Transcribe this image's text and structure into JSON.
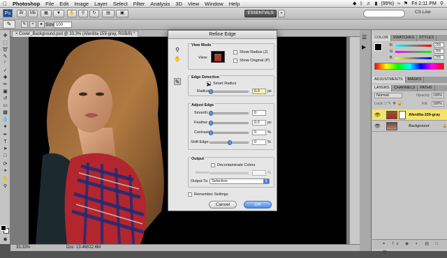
{
  "menubar": {
    "app_name": "Photoshop",
    "items": [
      "File",
      "Edit",
      "Image",
      "Layer",
      "Select",
      "Filter",
      "Analysis",
      "3D",
      "View",
      "Window",
      "Help"
    ],
    "ps_badge": "Ps",
    "battery": "(99%)",
    "clock": "Fri 2:11 PM"
  },
  "appbar": {
    "workspace": "ESSENTIALS",
    "cs_live": "CS Live"
  },
  "options": {
    "size_label": "Size:",
    "size_value": "100"
  },
  "document": {
    "tab_title": "Cover_Background.psd @ 33.3% (Aferdita-159-gray, RGB/8) *",
    "zoom": "33.33%",
    "doc_info": "Doc: 13.4M/22.6M"
  },
  "panels": {
    "color_tabs": [
      "COLOR",
      "SWATCHES",
      "STYLES"
    ],
    "adj_tabs": [
      "ADJUSTMENTS",
      "MASKS"
    ],
    "layer_tabs": [
      "LAYERS",
      "CHANNELS",
      "PATHS"
    ],
    "blend_mode": "Normal",
    "opacity_label": "Opacity:",
    "opacity_value": "100%",
    "lock_label": "Lock:",
    "fill_label": "Fill:",
    "fill_value": "100%",
    "channels": [
      "R",
      "G",
      "B"
    ],
    "channel_values": [
      "255",
      "255",
      "255"
    ],
    "layers": [
      {
        "name": "Aferdita-159-gray",
        "selected": true
      },
      {
        "name": "Background",
        "selected": false
      }
    ]
  },
  "dialog": {
    "title": "Refine Edge",
    "view_mode": {
      "title": "View Mode",
      "view_label": "View:",
      "show_radius": "Show Radius (J)",
      "show_original": "Show Original (P)"
    },
    "edge_detection": {
      "title": "Edge Detection",
      "smart_radius": "Smart Radius",
      "radius_label": "Radius:",
      "radius_value": "0.0",
      "radius_unit": "px"
    },
    "adjust_edge": {
      "title": "Adjust Edge",
      "smooth_label": "Smooth:",
      "smooth_value": "0",
      "feather_label": "Feather:",
      "feather_value": "0.0",
      "feather_unit": "px",
      "contrast_label": "Contrast:",
      "contrast_value": "0",
      "contrast_unit": "%",
      "shift_label": "Shift Edge:",
      "shift_value": "0",
      "shift_unit": "%"
    },
    "output": {
      "title": "Output",
      "decontaminate": "Decontaminate Colors",
      "amount_label": "Amount:",
      "amount_unit": "%",
      "output_to_label": "Output To:",
      "output_to_value": "Selection"
    },
    "remember": "Remember Settings",
    "cancel": "Cancel",
    "ok": "OK"
  },
  "colors": {
    "ui_bg": "#535353",
    "accent_blue": "#4b8ae3",
    "selected_layer": "#f5e46a"
  }
}
